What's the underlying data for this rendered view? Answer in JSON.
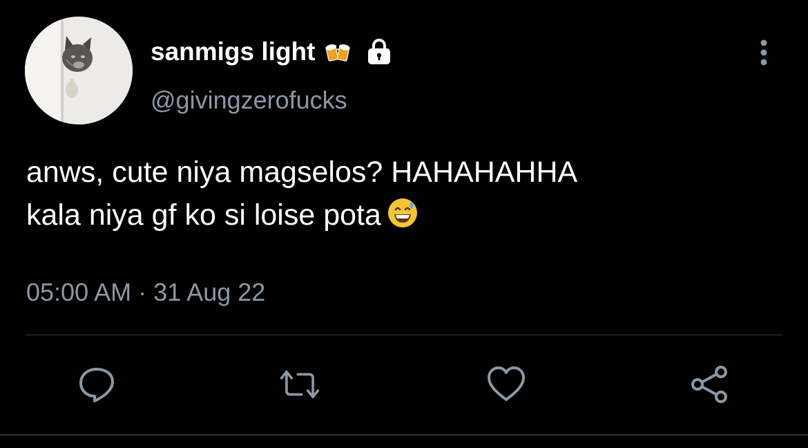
{
  "tweet": {
    "display_name": "sanmigs light",
    "name_emoji": "beer-mugs-icon",
    "protected_icon": "lock-icon",
    "handle": "@givingzerofucks",
    "text_line_1": "anws, cute niya magselos? HAHAHAHHA",
    "text_line_2": "kala niya gf ko si loise pota",
    "text_emoji": "grinning-face-with-sweat-icon",
    "time": "05:00 AM",
    "separator": "·",
    "date": "31 Aug 22"
  },
  "actions": [
    {
      "name": "reply",
      "icon": "comment-icon"
    },
    {
      "name": "retweet",
      "icon": "retweet-icon"
    },
    {
      "name": "like",
      "icon": "heart-icon"
    },
    {
      "name": "share",
      "icon": "share-icon"
    }
  ],
  "colors": {
    "background": "#000000",
    "primary_text": "#ffffff",
    "secondary_text": "#8b98a5",
    "divider": "#2f3336"
  }
}
